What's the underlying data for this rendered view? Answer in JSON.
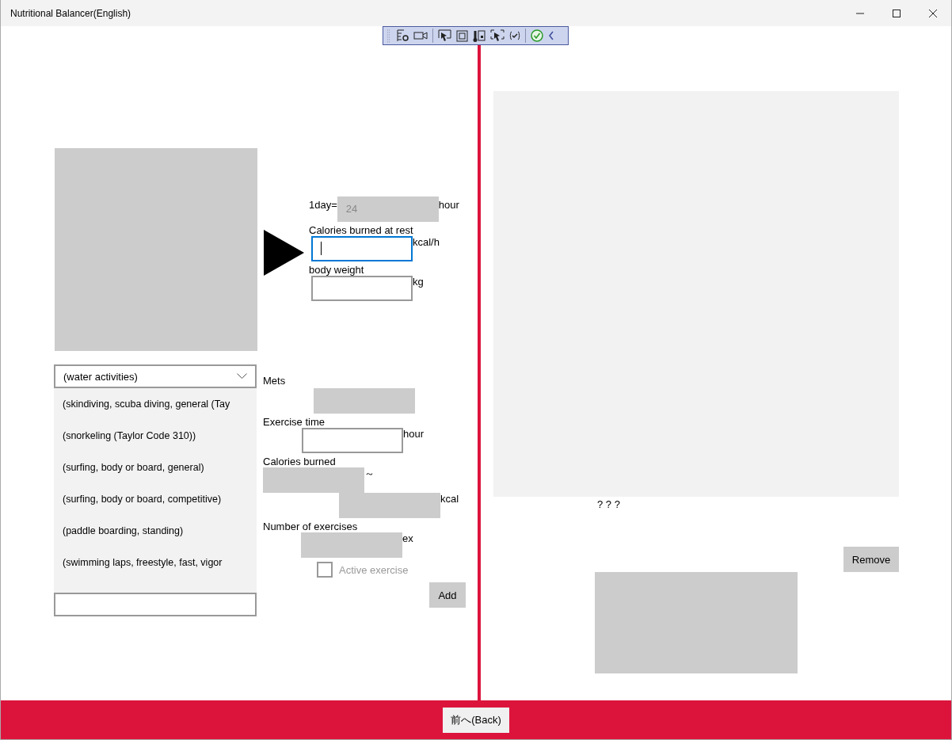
{
  "window": {
    "title": "Nutritional Balancer(English)"
  },
  "day": {
    "label": "1day=",
    "value": "24",
    "unit": "hour"
  },
  "rest_calories": {
    "label": "Calories burned at rest",
    "unit": "kcal/h",
    "focused": true
  },
  "body_weight": {
    "label": "body weight",
    "unit": "kg",
    "focused": false
  },
  "activity_dropdown": {
    "value": "(water activities)",
    "expanded": true
  },
  "activity_list": [
    {
      "label": "(skindiving, scuba diving, general (Tay",
      "selected": false
    },
    {
      "label": "(snorkeling (Taylor Code 310))",
      "selected": false
    },
    {
      "label": "(surfing, body or board, general)",
      "selected": false
    },
    {
      "label": "(surfing, body or board, competitive)",
      "selected": false
    },
    {
      "label": "(paddle boarding, standing)",
      "selected": false
    },
    {
      "label": "(swimming laps, freestyle, fast, vigor",
      "selected": false
    }
  ],
  "mets": {
    "label": "Mets"
  },
  "exercise_time": {
    "label": "Exercise time",
    "unit": "hour"
  },
  "calories_burned": {
    "label": "Calories burned",
    "separator": "～",
    "unit": "kcal"
  },
  "number_of_exercises": {
    "label": "Number of exercises",
    "unit": "ex"
  },
  "active_exercise": {
    "label": "Active exercise",
    "checked": false,
    "disabled": true
  },
  "add_button": "Add",
  "result": {
    "marks": "? ? ?",
    "remove_button": "Remove"
  },
  "back_button": "前へ(Back)"
}
